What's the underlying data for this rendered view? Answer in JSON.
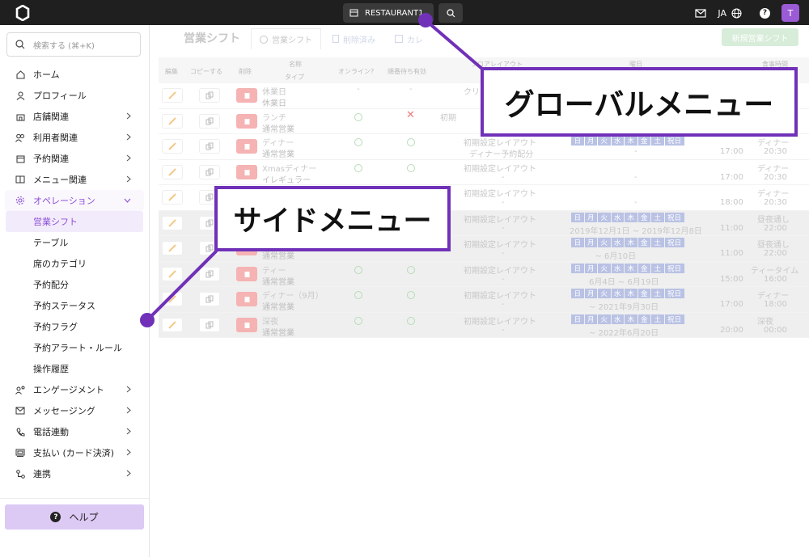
{
  "topbar": {
    "store_name": "RESTAURANT1",
    "language": "JA",
    "avatar_initial": "T"
  },
  "sidebar": {
    "search_placeholder": "検索する (⌘+K)",
    "items": [
      {
        "label": "ホーム",
        "icon": "home-icon",
        "expandable": false
      },
      {
        "label": "プロフィール",
        "icon": "user-icon",
        "expandable": false
      },
      {
        "label": "店舗関連",
        "icon": "store-icon",
        "expandable": true
      },
      {
        "label": "利用者関連",
        "icon": "users-icon",
        "expandable": true
      },
      {
        "label": "予約関連",
        "icon": "calendar-icon",
        "expandable": true
      },
      {
        "label": "メニュー関連",
        "icon": "menu-book-icon",
        "expandable": true
      },
      {
        "label": "オペレーション",
        "icon": "gear-icon",
        "expandable": true,
        "expanded": true
      }
    ],
    "operation_sub": [
      {
        "label": "営業シフト",
        "selected": true
      },
      {
        "label": "テーブル"
      },
      {
        "label": "席のカテゴリ"
      },
      {
        "label": "予約配分"
      },
      {
        "label": "予約ステータス"
      },
      {
        "label": "予約フラグ"
      },
      {
        "label": "予約アラート・ルール"
      },
      {
        "label": "操作履歴"
      }
    ],
    "items_after": [
      {
        "label": "エンゲージメント",
        "icon": "engagement-icon",
        "expandable": true
      },
      {
        "label": "メッセージング",
        "icon": "mail-icon",
        "expandable": true
      },
      {
        "label": "電話連動",
        "icon": "phone-icon",
        "expandable": true
      },
      {
        "label": "支払い (カード決済)",
        "icon": "payment-icon",
        "expandable": true
      },
      {
        "label": "連携",
        "icon": "link-icon",
        "expandable": true
      }
    ],
    "help_label": "ヘルプ"
  },
  "main": {
    "title": "営業シフト",
    "tabs": [
      {
        "label": "営業シフト",
        "icon": "clock-icon"
      },
      {
        "label": "削除済み",
        "icon": "trash-icon"
      },
      {
        "label": "カレ",
        "icon": "calendar-icon"
      }
    ],
    "new_button": "新規営業シフト",
    "columns": {
      "edit": "編集",
      "copy": "コピーする",
      "delete": "削除",
      "name": "名称",
      "type": "タイプ",
      "online": "オンライン?",
      "waitlist": "順番待ち有効",
      "layout": "フロアレイアウト",
      "weekday": "曜日",
      "meal_time": "食事時間"
    },
    "days": [
      "日",
      "月",
      "火",
      "水",
      "木",
      "金",
      "土",
      "祝日"
    ],
    "rows": [
      {
        "name": "休業日",
        "type": "休業日",
        "online": "-",
        "waitlist": "-",
        "layout": "クリスマス",
        "layout2": "",
        "has_days": false,
        "period": "",
        "start": "",
        "meal1": "",
        "meal2": "",
        "dim": false
      },
      {
        "name": "ランチ",
        "type": "通常営業",
        "online": "circle",
        "waitlist": "cross",
        "layout": "初期",
        "layout2": "-",
        "has_days": false,
        "period": "",
        "start": "",
        "meal1": "",
        "meal2": "",
        "dim": false
      },
      {
        "name": "ディナー",
        "type": "通常営業",
        "online": "circle",
        "waitlist": "circle",
        "layout": "初期設定レイアウト",
        "layout2": "ディナー予約配分",
        "has_days": true,
        "period": "-",
        "start": "17:00",
        "meal1": "ディナー",
        "meal2": "20:30",
        "dim": false
      },
      {
        "name": "Xmasディナー",
        "type": "イレギュラー",
        "online": "circle",
        "waitlist": "circle",
        "layout": "初期設定レイアウト",
        "layout2": "-",
        "has_days": false,
        "period": "-",
        "start": "17:00",
        "meal1": "ディナー",
        "meal2": "20:30",
        "dim": false
      },
      {
        "name": "",
        "type": "",
        "online": "",
        "waitlist": "",
        "layout": "初期設定レイアウト",
        "layout2": "-",
        "has_days": false,
        "period": "-",
        "start": "18:00",
        "meal1": "ディナー",
        "meal2": "20:30",
        "dim": false
      },
      {
        "name": "",
        "type": "",
        "online": "",
        "waitlist": "",
        "layout": "初期設定レイアウト",
        "layout2": "-",
        "has_days": true,
        "period": "2019年12月1日 ~ 2019年12月8日",
        "start": "11:00",
        "meal1": "昼夜通し",
        "meal2": "22:00",
        "dim": true
      },
      {
        "name": "",
        "type": "通常営業",
        "online": "",
        "waitlist": "",
        "layout": "初期設定レイアウト",
        "layout2": "-",
        "has_days": true,
        "period": "~ 6月10日",
        "start": "11:00",
        "meal1": "昼夜通し",
        "meal2": "22:00",
        "dim": true
      },
      {
        "name": "ティー",
        "type": "通常営業",
        "online": "circle",
        "waitlist": "circle",
        "layout": "初期設定レイアウト",
        "layout2": "-",
        "has_days": true,
        "period": "6月4日 ~ 6月19日",
        "start": "15:00",
        "meal1": "ティータイム",
        "meal2": "16:00",
        "dim": true
      },
      {
        "name": "ディナー（9月）",
        "type": "通常営業",
        "online": "circle",
        "waitlist": "circle",
        "layout": "初期設定レイアウト",
        "layout2": "-",
        "has_days": true,
        "period": "~ 2021年9月30日",
        "start": "17:00",
        "meal1": "ディナー",
        "meal2": "18:00",
        "dim": true
      },
      {
        "name": "深夜",
        "type": "通常営業",
        "online": "circle",
        "waitlist": "circle",
        "layout": "初期設定レイアウト",
        "layout2": "-",
        "has_days": true,
        "period": "~ 2022年6月20日",
        "start": "20:00",
        "meal1": "深夜",
        "meal2": "00:00",
        "dim": true
      }
    ]
  },
  "callouts": {
    "global_menu": "グローバルメニュー",
    "side_menu": "サイドメニュー"
  },
  "colors": {
    "accent": "#8e4fd6",
    "callout_border": "#7030b8",
    "topbar": "#1f1f1f"
  }
}
